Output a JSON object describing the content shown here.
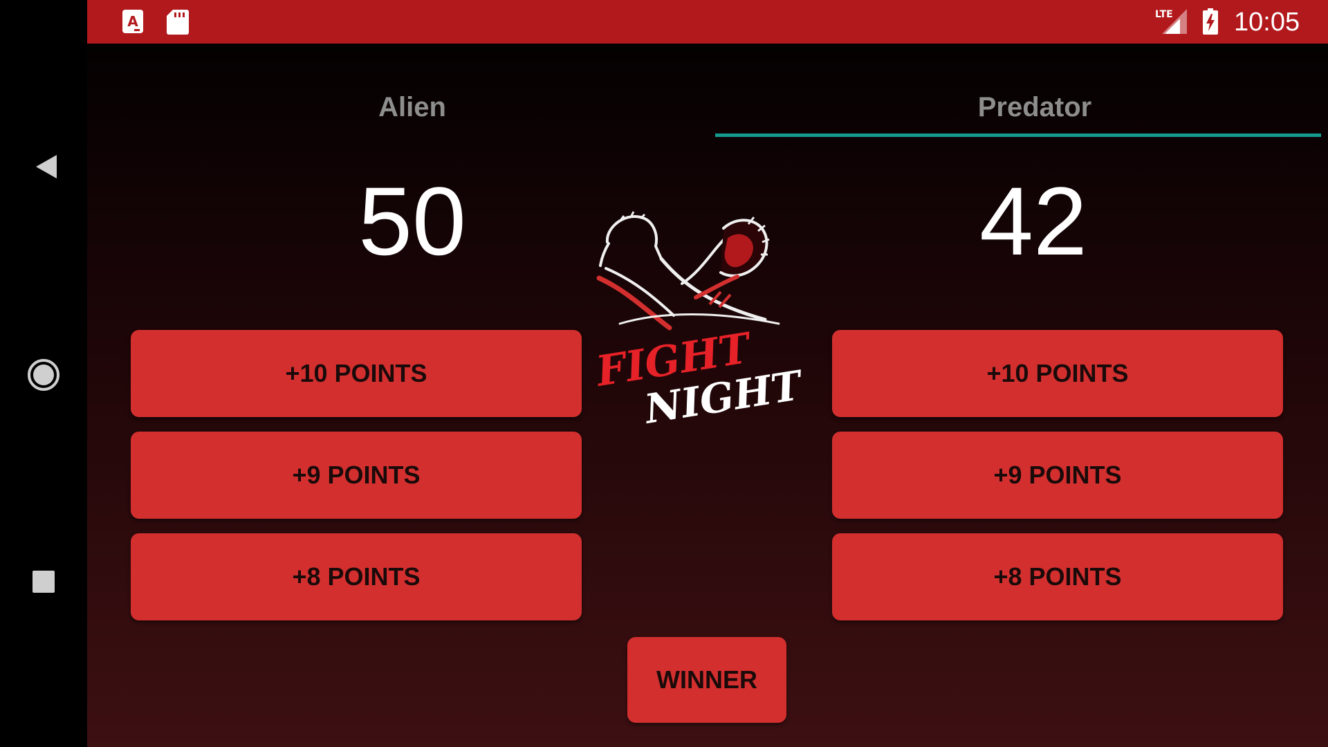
{
  "status_bar": {
    "icons": [
      "app-a-icon",
      "sd-card-icon",
      "lte-signal-icon",
      "battery-charging-icon"
    ],
    "clock": "10:05"
  },
  "navigation_bar": {
    "icons": [
      "back-icon",
      "home-icon",
      "recents-icon"
    ]
  },
  "teams": [
    {
      "name": "Alien",
      "score": "50",
      "selected": false
    },
    {
      "name": "Predator",
      "score": "42",
      "selected": true
    }
  ],
  "buttons": {
    "plus10": "+10 POINTS",
    "plus9": "+9 POINTS",
    "plus8": "+8 POINTS",
    "winner": "WINNER"
  },
  "logo": {
    "line1": "FIGHT",
    "line2": "NIGHT",
    "icon": "arm-wrestling-icon"
  },
  "colors": {
    "status_bar": "#b2191d",
    "button": "#d32f2f",
    "tab_indicator": "#159a8f",
    "team_name": "#8e8e8e"
  }
}
